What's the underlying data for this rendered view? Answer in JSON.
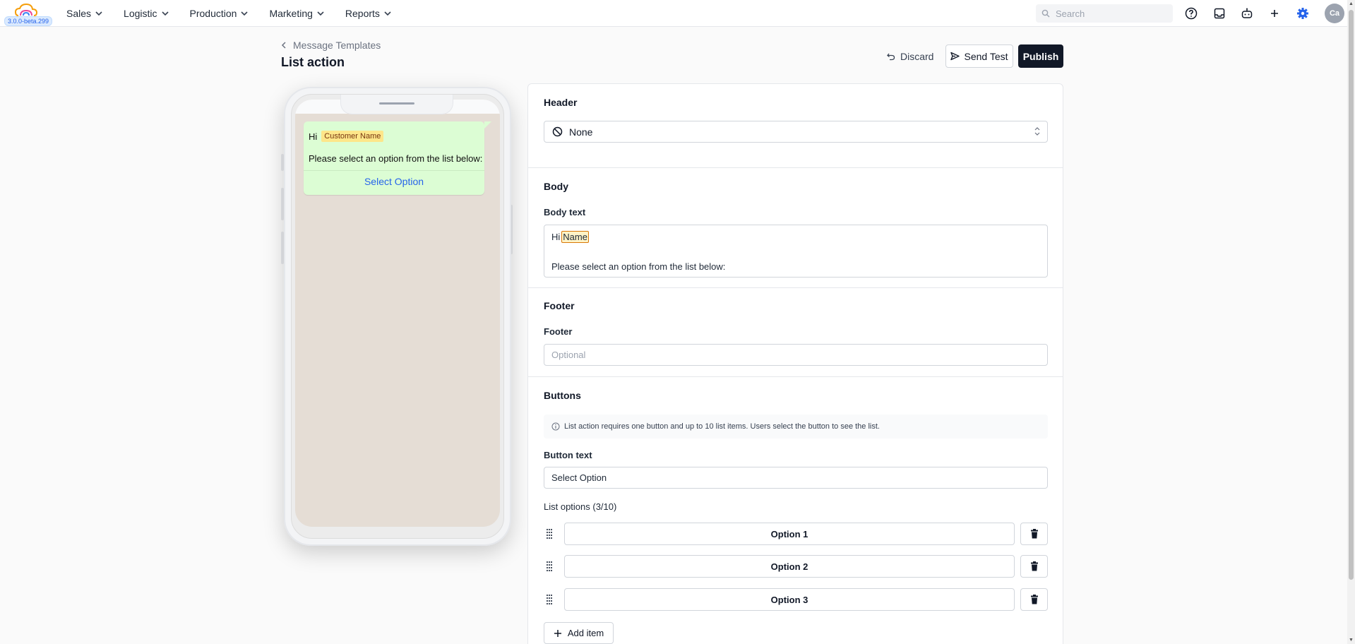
{
  "app": {
    "version": "3.0.0-beta.299",
    "accent_color": "#2563eb"
  },
  "nav": {
    "items": [
      {
        "label": "Sales"
      },
      {
        "label": "Logistic"
      },
      {
        "label": "Production"
      },
      {
        "label": "Marketing"
      },
      {
        "label": "Reports"
      }
    ]
  },
  "search": {
    "placeholder": "Search"
  },
  "user": {
    "initials": "Ca"
  },
  "page": {
    "breadcrumb": "Message Templates",
    "title": "List action"
  },
  "actions": {
    "discard": "Discard",
    "send_test": "Send Test",
    "publish": "Publish"
  },
  "preview": {
    "greeting": "Hi",
    "variable_chip": "Customer Name",
    "body_line": "Please select an option from the list below:",
    "button_label": "Select Option",
    "bubble_color": "#dcfdd4",
    "chat_background": "#e5ddd5"
  },
  "form": {
    "header": {
      "section_title": "Header",
      "selected": "None"
    },
    "body": {
      "section_title": "Body",
      "field_label": "Body text",
      "line1_text": "Hi",
      "line1_var": "Name",
      "line2": "Please select an option from the list below:"
    },
    "footer": {
      "section_title": "Footer",
      "field_label": "Footer",
      "placeholder": "Optional"
    },
    "buttons": {
      "section_title": "Buttons",
      "info": "List action requires one button and up to 10 list items. Users select the button to see the list.",
      "button_text_label": "Button text",
      "button_text_value": "Select Option",
      "list_label": "List options (3/10)",
      "options": [
        {
          "label": "Option 1"
        },
        {
          "label": "Option 2"
        },
        {
          "label": "Option 3"
        }
      ],
      "add_item": "Add item"
    }
  }
}
